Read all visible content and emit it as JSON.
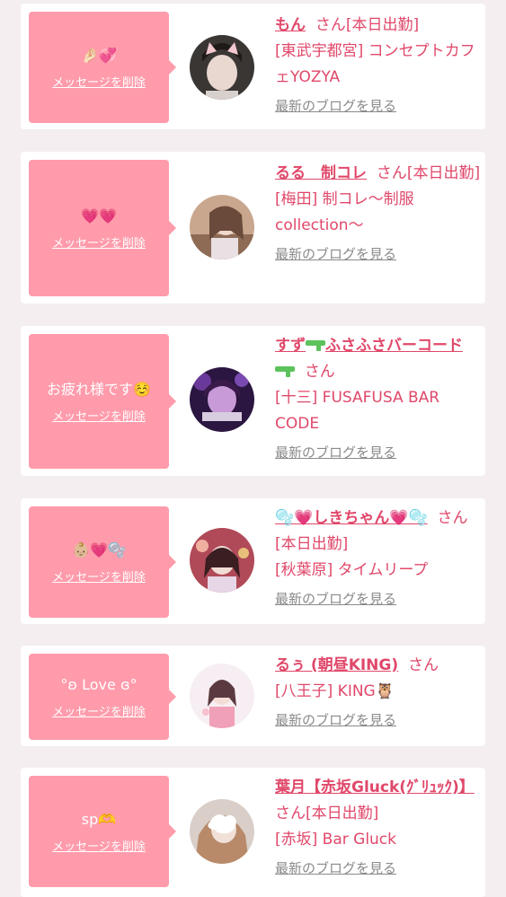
{
  "common": {
    "delete_label": "メッセージを削除",
    "san": "さん",
    "blog_label": "最新のブログを見る"
  },
  "items": [
    {
      "message": "🤌🏻💞",
      "name": "もん",
      "status": "[本日出勤]",
      "shop": "[東武宇都宮] コンセプトカフェYOZYA"
    },
    {
      "message": "💗💗",
      "name": "るる　制コレ",
      "status": "[本日出勤]",
      "shop": "[梅田] 制コレ〜制服collection〜"
    },
    {
      "message": "お疲れ様です☺️",
      "name_parts": [
        "すず",
        "ふさふさバーコード",
        ""
      ],
      "name_icon": "water-pistol-icon",
      "status": "",
      "shop": "[十三] FUSAFUSA BAR CODE"
    },
    {
      "message": "👶🏼💗🫧",
      "name": "🫧💗しきちゃん💗🫧",
      "status": "[本日出勤]",
      "shop": "[秋葉原] タイムリープ"
    },
    {
      "message": "°ʚ Love ɞ°",
      "name": "るぅ (朝昼KING)",
      "status": "",
      "shop": "[八王子] KING🦉"
    },
    {
      "message": "sp🫶",
      "name": "葉月【赤坂Gluck(ｸﾞﾘｭｯｸ)】",
      "status": "[本日出勤]",
      "shop": "[赤坂] Bar Gluck"
    }
  ],
  "colors": {
    "bubble": "#ff9bab",
    "accent": "#e0486a",
    "muted": "#8a8a8a",
    "background": "#f4eef0",
    "pistol": "#5cc25c"
  }
}
